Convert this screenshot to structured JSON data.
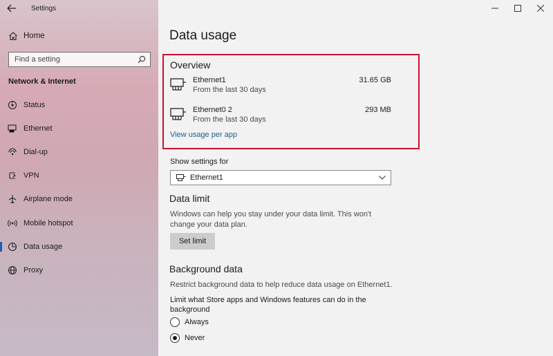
{
  "app": {
    "title": "Settings"
  },
  "sidebar": {
    "home_label": "Home",
    "search_placeholder": "Find a setting",
    "section_title": "Network & Internet",
    "items": [
      {
        "label": "Status",
        "icon": "status-icon"
      },
      {
        "label": "Ethernet",
        "icon": "ethernet-icon"
      },
      {
        "label": "Dial-up",
        "icon": "dialup-icon"
      },
      {
        "label": "VPN",
        "icon": "vpn-icon"
      },
      {
        "label": "Airplane mode",
        "icon": "airplane-icon"
      },
      {
        "label": "Mobile hotspot",
        "icon": "hotspot-icon"
      },
      {
        "label": "Data usage",
        "icon": "data-usage-icon",
        "active": true
      },
      {
        "label": "Proxy",
        "icon": "globe-icon"
      }
    ]
  },
  "main": {
    "title": "Data usage",
    "overview": {
      "title": "Overview",
      "rows": [
        {
          "name": "Ethernet1",
          "subtitle": "From the last 30 days",
          "value": "31.65 GB"
        },
        {
          "name": "Ethernet0 2",
          "subtitle": "From the last 30 days",
          "value": "293 MB"
        }
      ],
      "link": "View usage per app"
    },
    "show_settings": {
      "label": "Show settings for",
      "selected": "Ethernet1"
    },
    "data_limit": {
      "title": "Data limit",
      "line1": "Windows can help you stay under your data limit. This won't",
      "line2": "change your data plan.",
      "button": "Set limit"
    },
    "background": {
      "title": "Background data",
      "desc": "Restrict background data to help reduce data usage on Ethernet1.",
      "question_line1": "Limit what Store apps and Windows features can do in the",
      "question_line2": "background",
      "options": [
        {
          "label": "Always",
          "selected": false
        },
        {
          "label": "Never",
          "selected": true
        }
      ]
    }
  },
  "colors": {
    "accent": "#1a5fb4",
    "highlight_border": "#c8102e",
    "link": "#1b5e8c"
  }
}
